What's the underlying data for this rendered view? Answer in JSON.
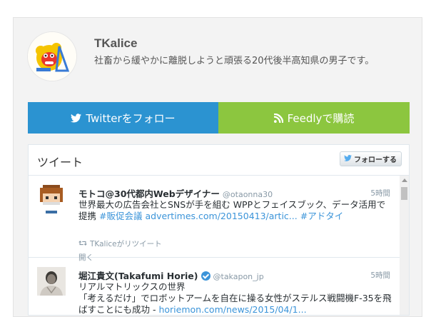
{
  "profile": {
    "name": "TKalice",
    "description": "社畜から緩やかに離脱しようと頑張る20代後半高知県の男子です。"
  },
  "buttons": {
    "twitter_label": "Twitterをフォロー",
    "feedly_label": "Feedlyで購読"
  },
  "timeline": {
    "title": "ツイート",
    "follow_button": "フォローする",
    "tweets": [
      {
        "name": "モトコ@30代都内Webデザイナー",
        "handle": "@otaonna30",
        "time": "5時間",
        "text": "世界最大の広告会社とSNSが手を組む WPPとフェイスブック、データ活用で提携",
        "hashtag1": "#販促会議",
        "link": "advertimes.com/20150413/artic...",
        "hashtag2": "#アドタイ",
        "retweet": "TKaliceがリツイート",
        "open": "開く"
      },
      {
        "name": "堀江貴文(Takafumi Horie)",
        "handle": "@takapon_jp",
        "time": "5時間",
        "line1": "リアルマトリックスの世界",
        "text": "「考えるだけ」でロボットアームを自在に操る女性がステルス戦闘機F-35を飛ばすことにも成功 -",
        "link": "horiemon.com/news/2015/04/1..."
      }
    ]
  },
  "colors": {
    "twitter_button": "#2b93d1",
    "feedly_button": "#8cc63f",
    "link": "#3b94d9"
  }
}
